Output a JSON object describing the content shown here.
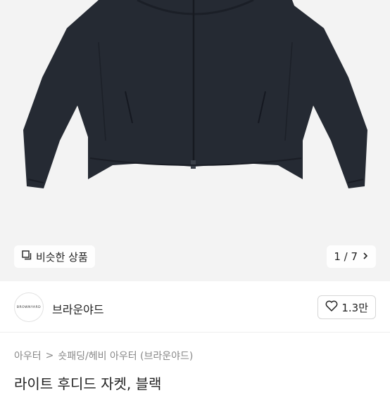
{
  "gallery": {
    "similar_label": "비슷한 상품",
    "counter": "1 / 7"
  },
  "shop": {
    "logo_text": "BROWNYARD",
    "name": "브라운야드",
    "likes": "1.3만"
  },
  "breadcrumb": {
    "first": "아우터",
    "separator": ">",
    "second": "숏패딩/헤비 아우터 (브라운야드)"
  },
  "product": {
    "title": "라이트 후디드 자켓, 블랙"
  },
  "icons": [
    "similar-icon",
    "chevron-right-icon",
    "heart-icon",
    "breadcrumb-chevron-icon"
  ]
}
